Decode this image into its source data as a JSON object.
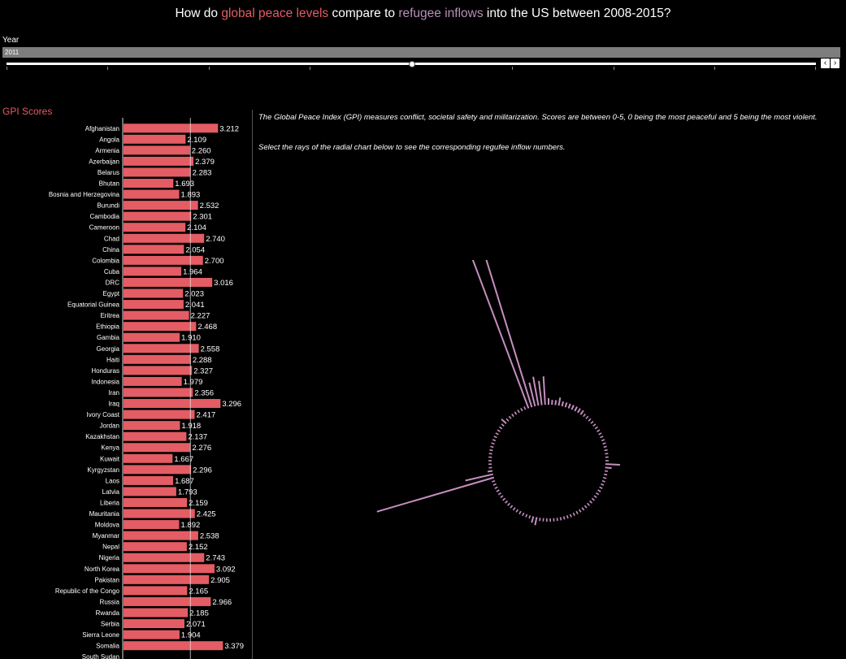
{
  "title": {
    "prefix": "How do ",
    "peace": "global peace levels",
    "middle": " compare to ",
    "refugee": "refugee inflows",
    "suffix": " into the US between 2008-2015?"
  },
  "filter": {
    "label": "Year",
    "value": "2011",
    "prev_icon": "‹",
    "next_icon": "›"
  },
  "gpi_panel": {
    "title": "GPI Scores"
  },
  "description": {
    "line1": "The Global Peace Index (GPI) measures conflict, societal safety and militarization. Scores are between 0-5, 0 being the most peaceful and 5 being the most violent.",
    "line2": "Select the rays of the radial chart below to see the corresponding regufee inflow numbers."
  },
  "colors": {
    "bar": "#e45c64",
    "ray": "#c58fc0",
    "highlight_peace": "#e45c64",
    "highlight_refugee": "#b98fba"
  },
  "chart_data": {
    "type": "bar",
    "orientation": "horizontal",
    "title": "GPI Scores",
    "reference_line": 2.3,
    "categories": [
      "Afghanistan",
      "Angola",
      "Armenia",
      "Azerbaijan",
      "Belarus",
      "Bhutan",
      "Bosnia and Herzegovina",
      "Burundi",
      "Cambodia",
      "Cameroon",
      "Chad",
      "China",
      "Colombia",
      "Cuba",
      "DRC",
      "Egypt",
      "Equatorial Guinea",
      "Eritrea",
      "Ethiopia",
      "Gambia",
      "Georgia",
      "Haiti",
      "Honduras",
      "Indonesia",
      "Iran",
      "Iraq",
      "Ivory Coast",
      "Jordan",
      "Kazakhstan",
      "Kenya",
      "Kuwait",
      "Kyrgyzstan",
      "Laos",
      "Latvia",
      "Liberia",
      "Mauritania",
      "Moldova",
      "Myanmar",
      "Nepal",
      "Nigeria",
      "North Korea",
      "Pakistan",
      "Republic of the Congo",
      "Russia",
      "Rwanda",
      "Serbia",
      "Sierra Leone",
      "Somalia",
      "South Sudan"
    ],
    "values": [
      3.212,
      2.109,
      2.26,
      2.379,
      2.283,
      1.693,
      1.893,
      2.532,
      2.301,
      2.104,
      2.74,
      2.054,
      2.7,
      1.964,
      3.016,
      2.023,
      2.041,
      2.227,
      2.468,
      1.91,
      2.558,
      2.288,
      2.327,
      1.979,
      2.356,
      3.296,
      2.417,
      1.918,
      2.137,
      2.276,
      1.667,
      2.296,
      1.687,
      1.793,
      2.159,
      2.425,
      1.892,
      2.538,
      2.152,
      2.743,
      3.092,
      2.905,
      2.165,
      2.966,
      2.185,
      2.071,
      1.904,
      3.379,
      null
    ],
    "labels": [
      "3.212",
      "2.109",
      "2.260",
      "2.379",
      "2.283",
      "1.693",
      "1.893",
      "2.532",
      "2.301",
      "2.104",
      "2.740",
      "2.054",
      "2.700",
      "1.964",
      "3.016",
      "2.023",
      "2.041",
      "2.227",
      "2.468",
      "1.910",
      "2.558",
      "2.288",
      "2.327",
      "1.979",
      "2.356",
      "3.296",
      "2.417",
      "1.918",
      "2.137",
      "2.276",
      "1.667",
      "2.296",
      "1.687",
      "1.793",
      "2.159",
      "2.425",
      "1.892",
      "2.538",
      "2.152",
      "2.743",
      "3.092",
      "2.905",
      "2.165",
      "2.966",
      "2.185",
      "2.071",
      "1.904",
      "3.379",
      ""
    ]
  },
  "radial_chart": {
    "type": "radial",
    "rays": [
      8,
      6,
      6,
      10,
      6,
      6,
      6,
      6,
      6,
      6,
      6,
      4,
      4,
      4,
      4,
      4,
      4,
      4,
      4,
      4,
      4,
      4,
      4,
      4,
      4,
      4,
      4,
      18,
      8,
      4,
      4,
      4,
      4,
      4,
      4,
      4,
      4,
      4,
      4,
      4,
      4,
      4,
      4,
      4,
      4,
      4,
      4,
      4,
      4,
      4,
      4,
      4,
      4,
      4,
      4,
      4,
      10,
      8,
      4,
      4,
      4,
      4,
      4,
      4,
      4,
      4,
      4,
      4,
      4,
      4,
      4,
      4,
      4,
      4,
      150,
      35,
      6,
      4,
      4,
      4,
      4,
      4,
      4,
      4,
      4,
      4,
      4,
      4,
      4,
      4,
      4,
      8,
      4,
      4,
      4,
      4,
      4,
      4,
      4,
      245,
      225,
      30,
      36,
      30,
      35
    ]
  }
}
